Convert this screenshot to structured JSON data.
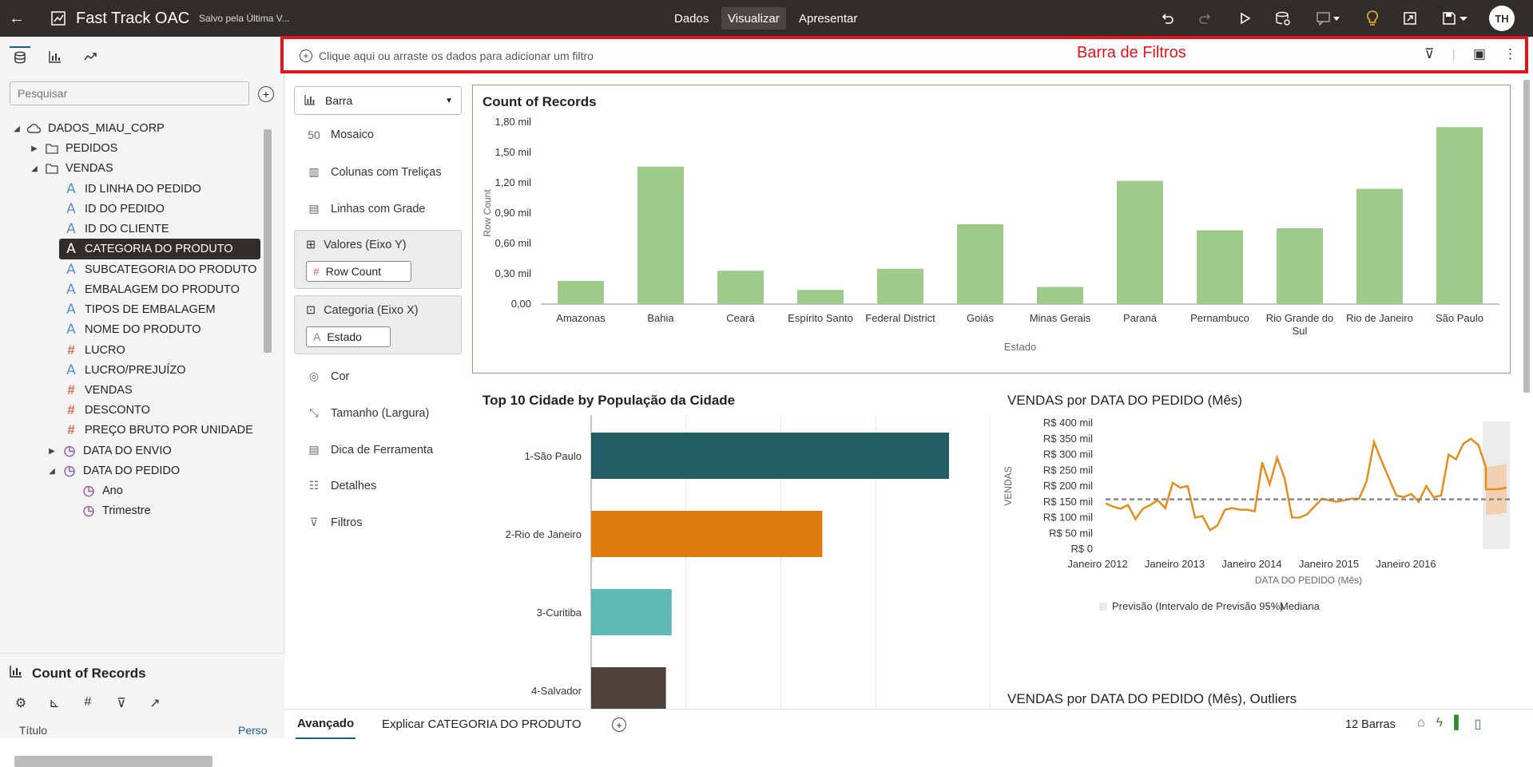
{
  "topbar": {
    "app_title": "Fast Track OAC",
    "save_status": "Salvo pela Última V...",
    "tabs": [
      "Dados",
      "Visualizar",
      "Apresentar"
    ],
    "active_tab": "Visualizar",
    "avatar_initials": "TH",
    "icons": [
      "back-arrow-icon",
      "app-icon",
      "undo-icon",
      "redo-icon",
      "play-icon",
      "refresh-data-icon",
      "comment-icon",
      "lightbulb-icon",
      "export-icon",
      "save-icon"
    ]
  },
  "left_panel": {
    "search_placeholder": "Pesquisar",
    "tree": [
      {
        "label": "DADOS_MIAU_CORP",
        "type": "dataset",
        "level": 0,
        "expanded": true
      },
      {
        "label": "PEDIDOS",
        "type": "folder",
        "level": 1,
        "expanded": false
      },
      {
        "label": "VENDAS",
        "type": "folder",
        "level": 1,
        "expanded": true
      },
      {
        "label": "ID LINHA DO PEDIDO",
        "type": "text",
        "level": 2
      },
      {
        "label": "ID DO PEDIDO",
        "type": "text",
        "level": 2
      },
      {
        "label": "ID DO CLIENTE",
        "type": "text",
        "level": 2
      },
      {
        "label": "CATEGORIA DO PRODUTO",
        "type": "text",
        "level": 2,
        "selected": true
      },
      {
        "label": "SUBCATEGORIA DO PRODUTO",
        "type": "text",
        "level": 2
      },
      {
        "label": "EMBALAGEM DO PRODUTO",
        "type": "text",
        "level": 2
      },
      {
        "label": "TIPOS DE EMBALAGEM",
        "type": "text",
        "level": 2
      },
      {
        "label": "NOME DO PRODUTO",
        "type": "text",
        "level": 2
      },
      {
        "label": "LUCRO",
        "type": "number",
        "level": 2
      },
      {
        "label": "LUCRO/PREJUÍZO",
        "type": "text",
        "level": 2
      },
      {
        "label": "VENDAS",
        "type": "number",
        "level": 2
      },
      {
        "label": "DESCONTO",
        "type": "number",
        "level": 2
      },
      {
        "label": "PREÇO BRUTO POR UNIDADE",
        "type": "number",
        "level": 2
      },
      {
        "label": "DATA DO ENVIO",
        "type": "time",
        "level": 2,
        "expanded": false
      },
      {
        "label": "DATA DO PEDIDO",
        "type": "time",
        "level": 2,
        "expanded": true
      },
      {
        "label": "Ano",
        "type": "time",
        "level": 3
      },
      {
        "label": "Trimestre",
        "type": "time",
        "level": 3
      }
    ],
    "properties": {
      "viz_title": "Count of Records",
      "title_label": "Título",
      "title_value": "Perso"
    }
  },
  "filter_bar": {
    "add_text": "Clique aqui ou arraste os dados para adicionar um filtro",
    "annotation": "Barra de Filtros"
  },
  "grammar": {
    "chart_type": "Barra",
    "items": [
      "Mosaico",
      "Colunas com Treliças",
      "Linhas com Grade"
    ],
    "values_y_label": "Valores (Eixo Y)",
    "values_y_pill": "Row Count",
    "category_x_label": "Categoria (Eixo X)",
    "category_x_pill": "Estado",
    "other_items": [
      "Cor",
      "Tamanho (Largura)",
      "Dica de Ferramenta",
      "Detalhes",
      "Filtros"
    ]
  },
  "bottom_bar": {
    "tab_active": "Avançado",
    "tab_explain": "Explicar CATEGORIA DO PRODUTO",
    "count_status": "12 Barras"
  },
  "chart_data": [
    {
      "type": "bar",
      "title": "Count of Records",
      "xlabel": "Estado",
      "ylabel": "Row Count",
      "color": "#9ecb8a",
      "categories": [
        "Amazonas",
        "Bahia",
        "Ceará",
        "Espírito Santo",
        "Federal District",
        "Goiás",
        "Minas Gerais",
        "Paraná",
        "Pernambuco",
        "Rio Grande do Sul",
        "Rio de Janeiro",
        "São Paulo"
      ],
      "values": [
        230,
        1360,
        330,
        140,
        350,
        790,
        170,
        1220,
        730,
        750,
        1140,
        1750
      ],
      "ytick_labels": [
        "0,00",
        "0,30 mil",
        "0,60 mil",
        "0,90 mil",
        "1,20 mil",
        "1,50 mil",
        "1,80 mil"
      ],
      "ylim": [
        0,
        1800
      ]
    },
    {
      "type": "bar",
      "orientation": "horizontal",
      "title": "Top 10 Cidade by População da Cidade",
      "categories": [
        "1-São Paulo",
        "2-Rio de Janeiro",
        "3-Curitiba",
        "4-Salvador"
      ],
      "values": [
        100,
        64.6,
        22.5,
        20.9
      ],
      "colors": [
        "#235d65",
        "#e07b10",
        "#5fbab5",
        "#4e413a"
      ]
    },
    {
      "type": "line",
      "title": "VENDAS por DATA DO PEDIDO (Mês)",
      "xlabel": "DATA DO PEDIDO (Mês)",
      "ylabel": "VENDAS",
      "x_tick_labels": [
        "Janeiro 2012",
        "Janeiro 2013",
        "Janeiro 2014",
        "Janeiro 2015",
        "Janeiro 2016"
      ],
      "ytick_labels": [
        "R$ 0",
        "R$ 50 mil",
        "R$ 100 mil",
        "R$ 150 mil",
        "R$ 200 mil",
        "R$ 250 mil",
        "R$ 300 mil",
        "R$ 350 mil",
        "R$ 400 mil"
      ],
      "ylim": [
        0,
        400
      ],
      "values": [
        145,
        135,
        128,
        140,
        95,
        128,
        140,
        155,
        130,
        210,
        195,
        200,
        100,
        105,
        60,
        75,
        125,
        130,
        125,
        125,
        120,
        275,
        205,
        290,
        225,
        100,
        100,
        110,
        135,
        160,
        155,
        150,
        155,
        160,
        160,
        215,
        340,
        280,
        225,
        170,
        165,
        175,
        150,
        200,
        165,
        170,
        300,
        285,
        335,
        350,
        330,
        260
      ],
      "forecast": [
        190,
        190,
        195
      ],
      "forecast_low": [
        110,
        110,
        115
      ],
      "forecast_high": [
        260,
        265,
        270
      ],
      "median": 158,
      "series_color": "#e58c1a",
      "legend": [
        "Previsão (Intervalo de Previsão 95%)",
        "Mediana"
      ]
    },
    {
      "type": "line",
      "title": "VENDAS por DATA DO PEDIDO (Mês), Outliers"
    }
  ]
}
